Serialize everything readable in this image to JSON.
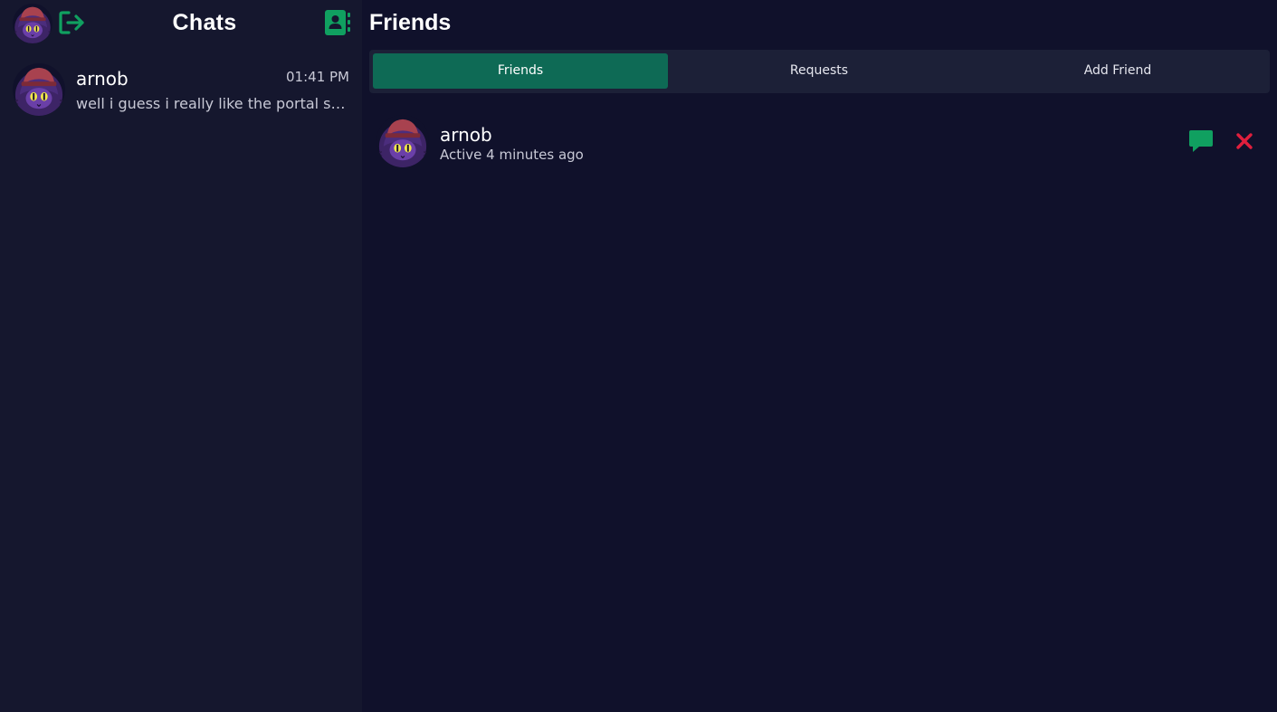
{
  "colors": {
    "accent": "#0e6a55",
    "icon_green": "#10a060",
    "danger": "#e01f3d",
    "background": "#10112b",
    "sidebar_background": "#15172e"
  },
  "sidebar": {
    "title": "Chats",
    "chats": [
      {
        "name": "arnob",
        "time": "01:41 PM",
        "preview": "well i guess i really like the portal seri..."
      }
    ]
  },
  "main": {
    "title": "Friends",
    "tabs": [
      {
        "label": "Friends",
        "active": true
      },
      {
        "label": "Requests",
        "active": false
      },
      {
        "label": "Add Friend",
        "active": false
      }
    ],
    "friends": [
      {
        "name": "arnob",
        "status": "Active 4 minutes ago"
      }
    ]
  },
  "icons": {
    "logout": "logout-icon",
    "contacts": "contacts-icon",
    "message": "message-icon",
    "remove": "close-icon"
  }
}
